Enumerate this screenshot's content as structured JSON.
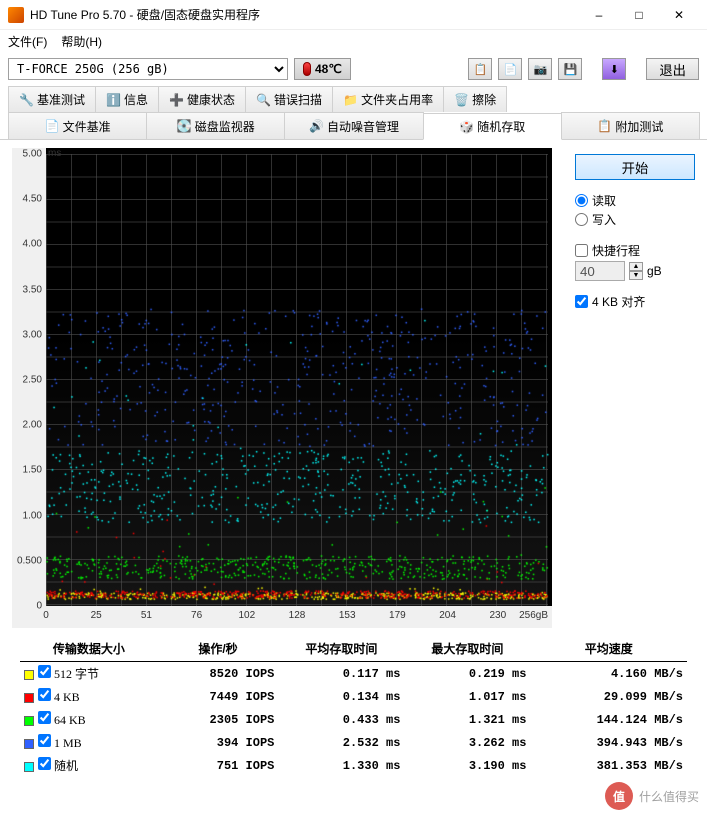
{
  "window": {
    "title": "HD Tune Pro 5.70 - 硬盘/固态硬盘实用程序"
  },
  "menu": {
    "file": "文件(F)",
    "help": "帮助(H)"
  },
  "toolbar": {
    "drive": "T-FORCE 250G (256 gB)",
    "temperature": "48℃",
    "exit": "退出"
  },
  "tabs": {
    "row1": [
      {
        "icon": "wrench",
        "label": "基准测试"
      },
      {
        "icon": "info",
        "label": "信息"
      },
      {
        "icon": "plus",
        "label": "健康状态"
      },
      {
        "icon": "search",
        "label": "错误扫描"
      },
      {
        "icon": "folder",
        "label": "文件夹占用率"
      },
      {
        "icon": "trash",
        "label": "擦除"
      }
    ],
    "row2": [
      {
        "icon": "file",
        "label": "文件基准"
      },
      {
        "icon": "disk",
        "label": "磁盘监视器"
      },
      {
        "icon": "sound",
        "label": "自动噪音管理"
      },
      {
        "icon": "random",
        "label": "随机存取",
        "active": true
      },
      {
        "icon": "extra",
        "label": "附加测试"
      }
    ]
  },
  "chart_data": {
    "type": "scatter",
    "title": "",
    "xlabel": "gB",
    "ylabel": "ms",
    "xlim": [
      0,
      256
    ],
    "ylim": [
      0,
      5.0
    ],
    "xticks": [
      "0",
      "25",
      "51",
      "76",
      "102",
      "128",
      "153",
      "179",
      "204",
      "230",
      "256gB"
    ],
    "yticks": [
      "5.00",
      "4.50",
      "4.00",
      "3.50",
      "3.00",
      "2.50",
      "2.00",
      "1.50",
      "1.00",
      "0.500",
      "0"
    ],
    "yunit": "ms",
    "series": [
      {
        "name": "512 字节",
        "color": "#ffff00",
        "mean_ms": 0.117,
        "max_ms": 0.219
      },
      {
        "name": "4 KB",
        "color": "#ff0000",
        "mean_ms": 0.134,
        "max_ms": 1.017
      },
      {
        "name": "64 KB",
        "color": "#00ff00",
        "mean_ms": 0.433,
        "max_ms": 1.321
      },
      {
        "name": "1 MB",
        "color": "#3060ff",
        "mean_ms": 2.532,
        "max_ms": 3.262
      },
      {
        "name": "随机",
        "color": "#00ffff",
        "mean_ms": 1.33,
        "max_ms": 3.19
      }
    ]
  },
  "controls": {
    "start": "开始",
    "read": "读取",
    "write": "写入",
    "shortstroke": "快捷行程",
    "shortstroke_value": "40",
    "shortstroke_unit": "gB",
    "align": "4 KB 对齐"
  },
  "results": {
    "headers": [
      "传输数据大小",
      "操作/秒",
      "平均存取时间",
      "最大存取时间",
      "平均速度"
    ],
    "rows": [
      {
        "color": "#ffff00",
        "label": "512 字节",
        "iops": "8520 IOPS",
        "avg": "0.117 ms",
        "max": "0.219 ms",
        "speed": "4.160 MB/s"
      },
      {
        "color": "#ff0000",
        "label": "4 KB",
        "iops": "7449 IOPS",
        "avg": "0.134 ms",
        "max": "1.017 ms",
        "speed": "29.099 MB/s"
      },
      {
        "color": "#00ff00",
        "label": "64 KB",
        "iops": "2305 IOPS",
        "avg": "0.433 ms",
        "max": "1.321 ms",
        "speed": "144.124 MB/s"
      },
      {
        "color": "#3060ff",
        "label": "1 MB",
        "iops": "394 IOPS",
        "avg": "2.532 ms",
        "max": "3.262 ms",
        "speed": "394.943 MB/s"
      },
      {
        "color": "#00ffff",
        "label": "随机",
        "iops": "751 IOPS",
        "avg": "1.330 ms",
        "max": "3.190 ms",
        "speed": "381.353 MB/s"
      }
    ]
  },
  "watermark": "什么值得买"
}
